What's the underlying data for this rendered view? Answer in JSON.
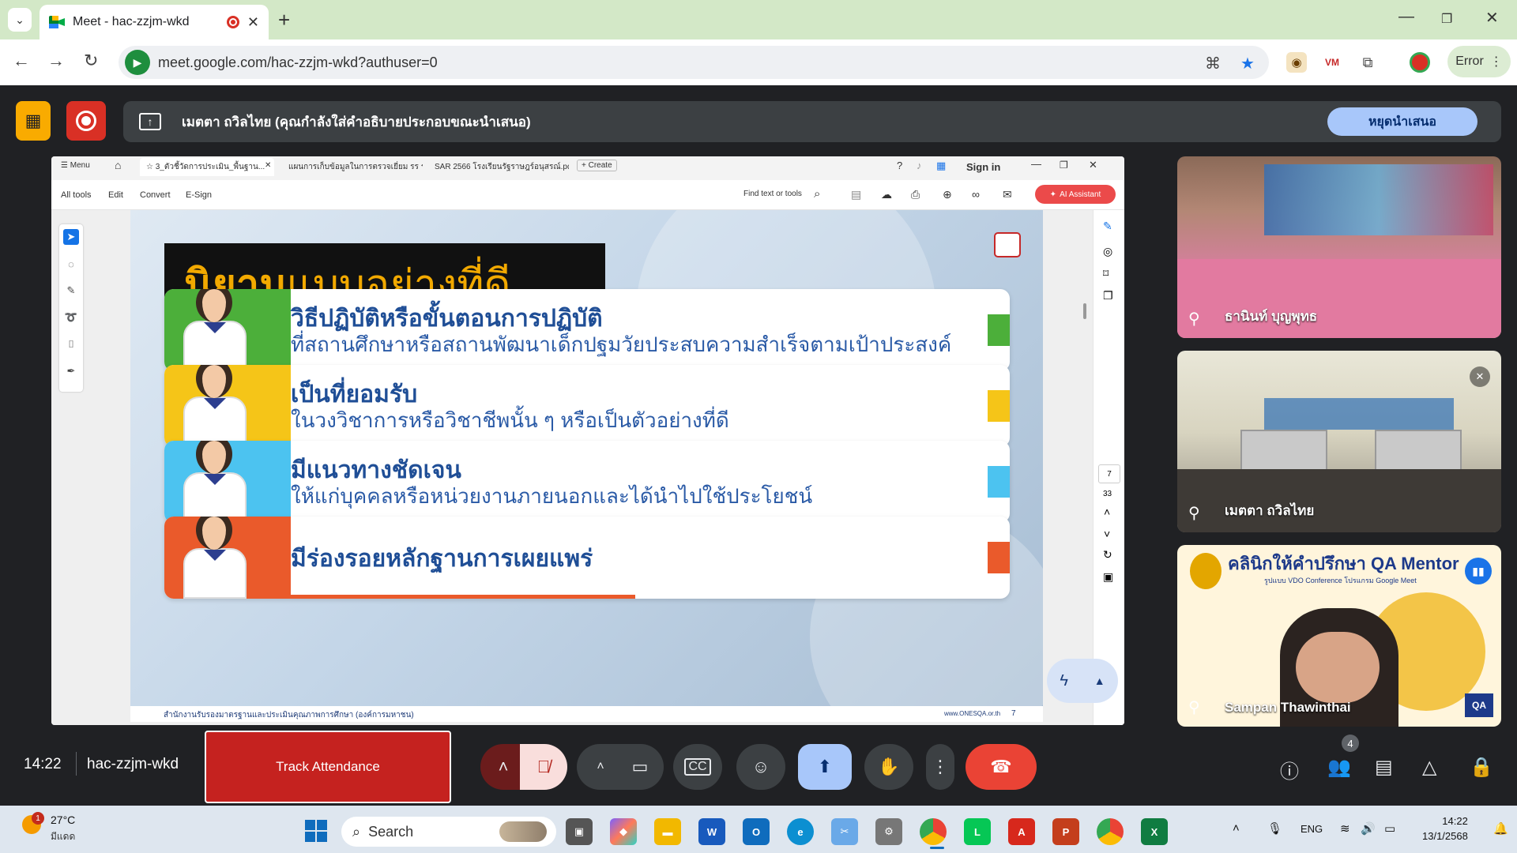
{
  "browser": {
    "tab_title": "Meet - hac-zzjm-wkd",
    "url": "meet.google.com/hac-zzjm-wkd?authuser=0",
    "profile_status": "Error"
  },
  "banner": {
    "text": "เมตตา ถวิลไทย (คุณกำลังใส่คำอธิบายประกอบขณะนำเสนอ)",
    "stop_label": "หยุดนำเสนอ"
  },
  "pdf": {
    "tabs": [
      "Menu",
      "3_ตัวชี้วัดการประเมิน_พื้นฐาน...",
      "แผนการเก็บข้อมูลในการตรวจเยี่ยม รร ร...",
      "SAR 2566 โรงเรียนรัฐราษฎร์อนุสรณ์.pdf",
      "Create"
    ],
    "sign_in": "Sign in",
    "tools": [
      "All tools",
      "Edit",
      "Convert",
      "E-Sign"
    ],
    "find_placeholder": "Find text or tools",
    "ai_label": "AI Assistant",
    "page_current": "7",
    "page_total": "33"
  },
  "slide": {
    "title_bold": "นิยาม",
    "title_rest": "แบบอย่างที่ดี",
    "cards": [
      {
        "title": "วิธีปฏิบัติหรือขั้นตอนการปฏิบัติ",
        "sub": "ที่สถานศึกษาหรือสถานพัฒนาเด็กปฐมวัยประสบความสำเร็จตามเป้าประสงค์",
        "color": "#4caf3a"
      },
      {
        "title": "เป็นที่ยอมรับ",
        "sub": "ในวงวิชาการหรือวิชาชีพนั้น ๆ หรือเป็นตัวอย่างที่ดี",
        "color": "#f5c518"
      },
      {
        "title": "มีแนวทางชัดเจน",
        "sub": "ให้แก่บุคคลหรือหน่วยงานภายนอกและได้นำไปใช้ประโยชน์",
        "color": "#4cc3f0"
      },
      {
        "title": "มีร่องรอยหลักฐานการเผยแพร่",
        "sub": "",
        "color": "#ea5a2b"
      }
    ],
    "footer_left": "สำนักงานรับรองมาตรฐานและประเมินคุณภาพการศึกษา (องค์การมหาชน)",
    "footer_right": "www.ONESQA.or.th",
    "footer_page": "7"
  },
  "participants": [
    {
      "name": "ธานินท์ บุญพุทธ"
    },
    {
      "name": "เมตตา ถวิลไทย"
    },
    {
      "name": "Sampan Thawinthai"
    }
  ],
  "tile3_banner": {
    "title": "คลินิกให้คำปรึกษา QA Mentor",
    "sub": "รูปแบบ VDO Conference โปรแกรม Google Meet"
  },
  "meet": {
    "time": "14:22",
    "code": "hac-zzjm-wkd",
    "track_label": "Track Attendance",
    "people_count": "4"
  },
  "taskbar": {
    "temp": "27°C",
    "condition": "มีแดด",
    "weather_badge": "1",
    "search": "Search",
    "lang": "ENG",
    "clock_time": "14:22",
    "clock_date": "13/1/2568"
  }
}
